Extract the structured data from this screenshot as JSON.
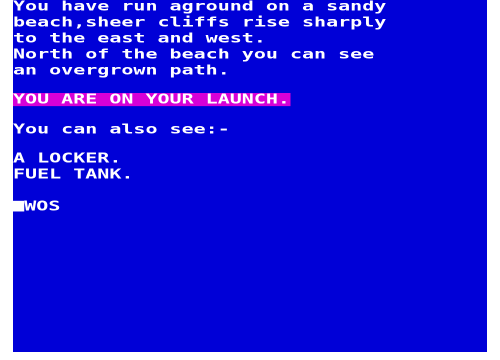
{
  "description": {
    "lines": [
      "You have run aground on a sandy",
      "beach,sheer cliffs rise sharply",
      "to the east and west.",
      "North of the beach you can see",
      "an overgrown path."
    ]
  },
  "location": {
    "text": "YOU ARE ON YOUR LAUNCH."
  },
  "items": {
    "header": "You can also see:-",
    "list": [
      "A LOCKER.",
      "FUEL TANK."
    ]
  },
  "input": {
    "prompt_symbol": ">",
    "value": "WOS"
  },
  "colors": {
    "background": "#0000d7",
    "text": "#ffffff",
    "highlight": "#d700d7",
    "border": "#ffffff"
  }
}
